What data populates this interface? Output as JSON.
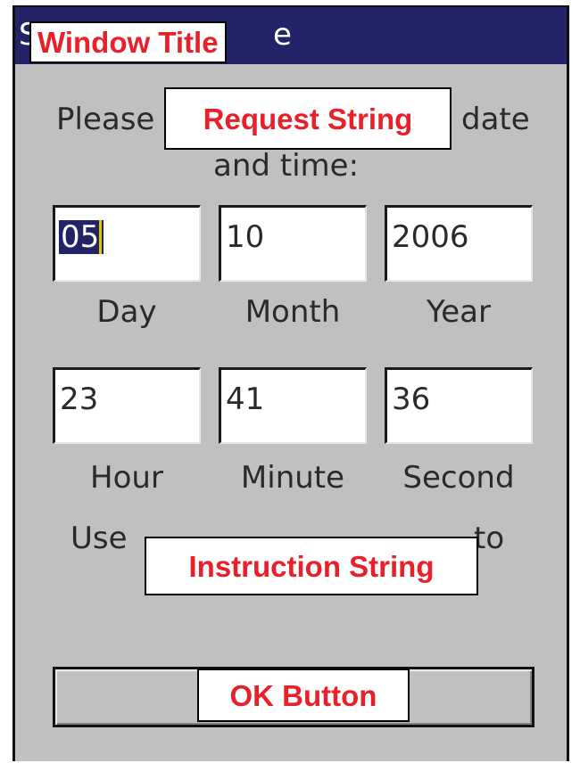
{
  "window": {
    "title_overlay": "Window Title",
    "title_peek_left": "S",
    "title_peek_right": "e"
  },
  "prompt": {
    "line1_prefix": "Please",
    "line1_suffix": "date",
    "line2": "and time:",
    "overlay": "Request String"
  },
  "date": {
    "day": "05",
    "month": "10",
    "year": "2006",
    "day_label": "Day",
    "month_label": "Month",
    "year_label": "Year"
  },
  "time": {
    "hour": "23",
    "minute": "41",
    "second": "36",
    "hour_label": "Hour",
    "minute_label": "Minute",
    "second_label": "Second"
  },
  "instruction": {
    "line1_prefix": "Use",
    "line1_suffix": "to",
    "overlay": "Instruction String"
  },
  "ok_button": {
    "overlay": "OK Button"
  },
  "colors": {
    "titlebar": "#232368",
    "window_bg": "#c0c0c0",
    "annotation_text": "#e8202a"
  }
}
